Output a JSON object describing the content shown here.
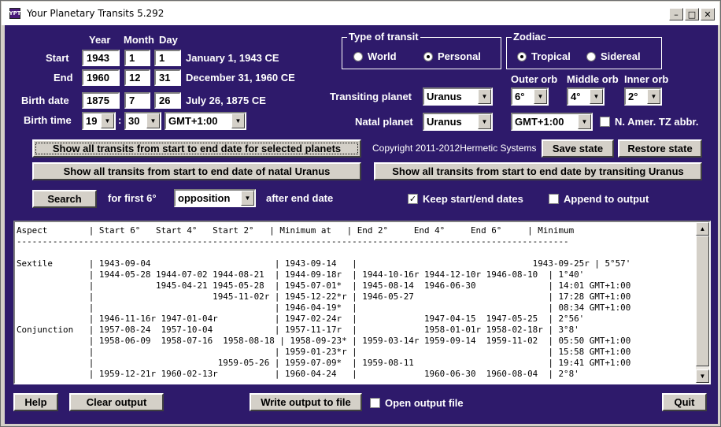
{
  "window": {
    "title": "Your Planetary Transits 5.292",
    "app_icon": "YPT"
  },
  "dates": {
    "col_year": "Year",
    "col_month": "Month",
    "col_day": "Day",
    "start_label": "Start",
    "start_year": "1943",
    "start_month": "1",
    "start_day": "1",
    "start_text": "January 1, 1943 CE",
    "end_label": "End",
    "end_year": "1960",
    "end_month": "12",
    "end_day": "31",
    "end_text": "December 31, 1960 CE",
    "birth_label": "Birth date",
    "birth_year": "1875",
    "birth_month": "7",
    "birth_day": "26",
    "birth_text": "July 26, 1875 CE",
    "birthtime_label": "Birth time",
    "hour": "19",
    "minute": "30",
    "tz": "GMT+1:00",
    "sep": ":"
  },
  "transit_type": {
    "title": "Type of transit",
    "world": "World",
    "personal": "Personal",
    "selected": "personal"
  },
  "zodiac": {
    "title": "Zodiac",
    "tropical": "Tropical",
    "sidereal": "Sidereal",
    "selected": "tropical"
  },
  "orbs": {
    "outer_label": "Outer orb",
    "middle_label": "Middle orb",
    "inner_label": "Inner orb",
    "outer": "6°",
    "middle": "4°",
    "inner": "2°"
  },
  "planets": {
    "transiting_label": "Transiting planet",
    "transiting": "Uranus",
    "natal_label": "Natal planet",
    "natal": "Uranus",
    "natal_tz": "GMT+1:00",
    "tz_abbr_label": "N. Amer. TZ abbr.",
    "tz_abbr_checked": false
  },
  "buttons": {
    "show_selected": "Show all transits from start to end date for selected planets",
    "show_natal": "Show all transits from start to end date of natal Uranus",
    "show_transiting": "Show all transits from start to end date by transiting Uranus",
    "save_state": "Save state",
    "restore_state": "Restore state",
    "search": "Search",
    "help": "Help",
    "clear_output": "Clear output",
    "write_output": "Write output to file",
    "quit": "Quit"
  },
  "copyright": "Copyright 2011-2012Hermetic Systems",
  "search": {
    "for_first": "for first 6°",
    "aspect": "opposition",
    "after": "after end date"
  },
  "options": {
    "keep_dates_label": "Keep start/end dates",
    "keep_dates_checked": true,
    "append_label": "Append to output",
    "append_checked": false,
    "open_output_label": "Open output file",
    "open_output_checked": false
  },
  "output": {
    "header": "Aspect        | Start 6°   Start 4°   Start 2°   | Minimum at   | End 2°     End 4°     End 6°     | Minimum",
    "divider": "-----------------------------------------------------------------------------------------------------------",
    "lines": [
      "",
      "Sextile       | 1943-09-04                        | 1943-09-14   |                                  1943-09-25r | 5°57'",
      "              | 1944-05-28 1944-07-02 1944-08-21  | 1944-09-18r  | 1944-10-16r 1944-12-10r 1946-08-10  | 1°40'",
      "              |            1945-04-21 1945-05-28  | 1945-07-01*  | 1945-08-14  1946-06-30              | 14:01 GMT+1:00",
      "              |                       1945-11-02r | 1945-12-22*r | 1946-05-27                          | 17:28 GMT+1:00",
      "              |                                   | 1946-04-19*  |                                     | 08:34 GMT+1:00",
      "              | 1946-11-16r 1947-01-04r           | 1947-02-24r  |             1947-04-15  1947-05-25  | 2°56'",
      "Conjunction   | 1957-08-24  1957-10-04            | 1957-11-17r  |             1958-01-01r 1958-02-18r | 3°8'",
      "              | 1958-06-09  1958-07-16  1958-08-18 | 1958-09-23* | 1959-03-14r 1959-09-14  1959-11-02  | 05:50 GMT+1:00",
      "              |                                   | 1959-01-23*r |                                     | 15:58 GMT+1:00",
      "              |                        1959-05-26 | 1959-07-09*  | 1959-08-11                          | 19:41 GMT+1:00",
      "              | 1959-12-21r 1960-02-13r           | 1960-04-24   |             1960-06-30  1960-08-04  | 2°8'"
    ]
  }
}
